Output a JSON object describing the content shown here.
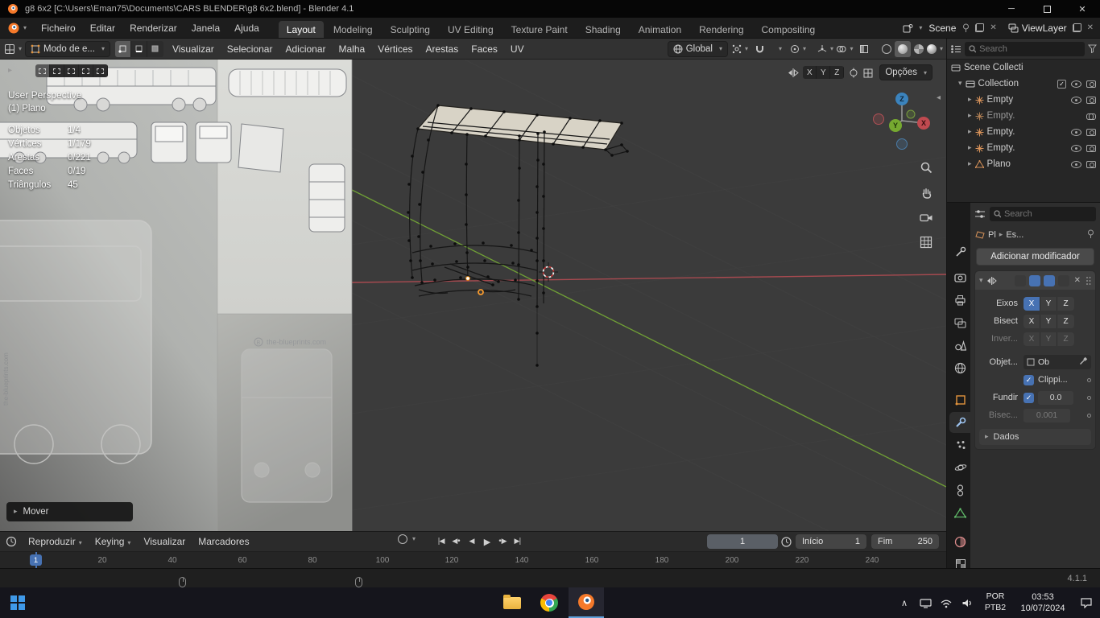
{
  "window": {
    "title": "g8 6x2 [C:\\Users\\Eman75\\Documents\\CARS BLENDER\\g8 6x2.blend] - Blender 4.1"
  },
  "topbar": {
    "menus": [
      "Ficheiro",
      "Editar",
      "Renderizar",
      "Janela",
      "Ajuda"
    ],
    "workspaces": [
      "Layout",
      "Modeling",
      "Sculpting",
      "UV Editing",
      "Texture Paint",
      "Shading",
      "Animation",
      "Rendering",
      "Compositing"
    ],
    "scene_label": "Scene",
    "view_layer_label": "ViewLayer"
  },
  "tool_header": {
    "mode": "Modo de e...",
    "menus": [
      "Visualizar",
      "Selecionar",
      "Adicionar",
      "Malha",
      "Vértices",
      "Arestas",
      "Faces",
      "UV"
    ],
    "orientation": "Global",
    "options_label": "Opções"
  },
  "axes": [
    "X",
    "Y",
    "Z"
  ],
  "viewport": {
    "view_name": "User Perspective",
    "object_name": "(1) Plano",
    "stats": [
      {
        "label": "Objetos",
        "value": "1/4"
      },
      {
        "label": "Vértices",
        "value": "1/179"
      },
      {
        "label": "Arestas",
        "value": "0/221"
      },
      {
        "label": "Faces",
        "value": "0/19"
      },
      {
        "label": "Triângulos",
        "value": "45"
      }
    ],
    "operator_panel_label": "Mover",
    "watermark": "the-blueprints.com"
  },
  "outliner": {
    "search_placeholder": "Search",
    "items": [
      {
        "label": "Scene Collecti"
      },
      {
        "label": "Collection"
      },
      {
        "label": "Empty"
      },
      {
        "label": "Empty."
      },
      {
        "label": "Empty."
      },
      {
        "label": "Empty."
      },
      {
        "label": "Plano"
      }
    ]
  },
  "properties": {
    "search_placeholder": "Search",
    "breadcrumb": {
      "object": "Pl",
      "data": "Es..."
    },
    "add_modifier_label": "Adicionar modificador",
    "modifier": {
      "axis_label": "Eixos",
      "bisect_label": "Bisect",
      "flip_label": "Inver...",
      "object_label": "Objet...",
      "object_value": "Ob",
      "clipping_label": "Clippi...",
      "merge_label": "Fundir",
      "merge_value": "0.0",
      "bisect_threshold_label": "Bisec...",
      "bisect_threshold_value": "0.001",
      "data_panel_label": "Dados"
    }
  },
  "timeline": {
    "menus": [
      "Reproduzir",
      "Keying",
      "Visualizar",
      "Marcadores"
    ],
    "current_frame": "1",
    "start_label": "Início",
    "start_value": "1",
    "end_label": "Fim",
    "end_value": "250",
    "playhead_label": "1",
    "ruler": [
      "20",
      "40",
      "60",
      "80",
      "100",
      "120",
      "140",
      "160",
      "180",
      "200",
      "220",
      "240"
    ]
  },
  "status_bar": {
    "version": "4.1.1"
  },
  "taskbar": {
    "language": "POR",
    "layout": "PTB2",
    "time": "03:53",
    "date": "10/07/2024"
  },
  "colors": {
    "accent": "#4772b3",
    "axis_x": "#a84a50",
    "axis_y": "#6f9e36",
    "axis_z": "#3b83bd"
  }
}
